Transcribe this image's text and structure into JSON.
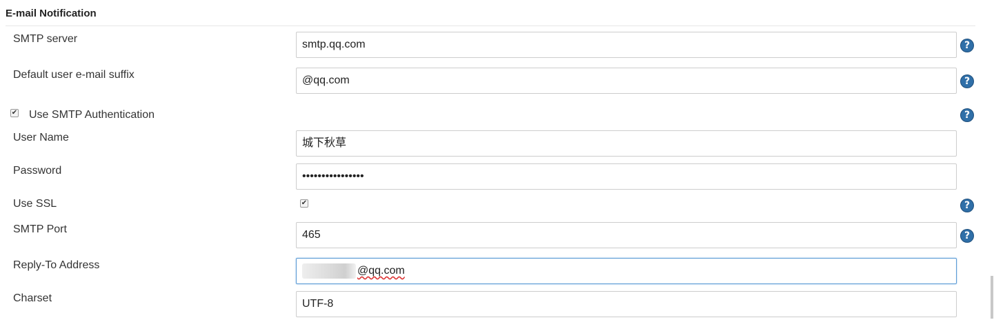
{
  "section": {
    "title": "E-mail Notification"
  },
  "fields": {
    "smtp_server": {
      "label": "SMTP server",
      "value": "smtp.qq.com"
    },
    "email_suffix": {
      "label": "Default user e-mail suffix",
      "value": "@qq.com"
    },
    "use_smtp_auth": {
      "label": "Use SMTP Authentication",
      "checked": true
    },
    "user_name": {
      "label": "User Name",
      "value": "城下秋草"
    },
    "password": {
      "label": "Password",
      "value": "••••••••••••••••"
    },
    "use_ssl": {
      "label": "Use SSL",
      "checked": true
    },
    "smtp_port": {
      "label": "SMTP Port",
      "value": "465"
    },
    "reply_to": {
      "label": "Reply-To Address",
      "value_visible": "@qq.com"
    },
    "charset": {
      "label": "Charset",
      "value": "UTF-8"
    }
  },
  "icons": {
    "help": "help-icon",
    "check": "check-icon"
  },
  "colors": {
    "focus_border": "#5b9bd5",
    "help_icon": "#2f6fa8"
  }
}
